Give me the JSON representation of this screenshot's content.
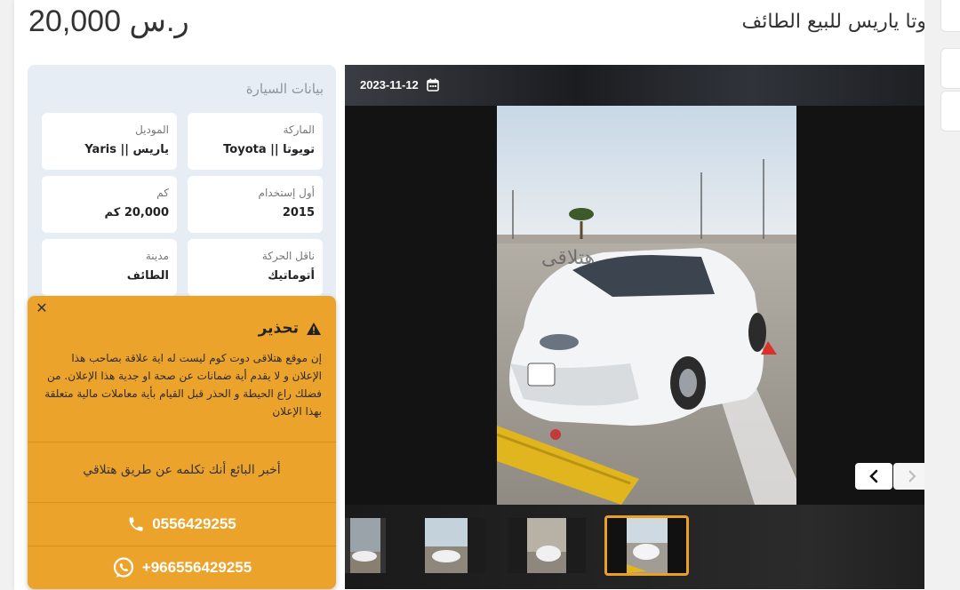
{
  "header": {
    "price": "20,000 ر.س",
    "title": "وتا ياريس للبيع الطائف"
  },
  "specs": {
    "section_title": "بيانات السيارة",
    "items": [
      {
        "label": "الماركة",
        "value": "تويوتا || Toyota"
      },
      {
        "label": "الموديل",
        "value": "ياريس || Yaris"
      },
      {
        "label": "أول إستخدام",
        "value": "2015"
      },
      {
        "label": "كم",
        "value": "20,000 كم"
      },
      {
        "label": "ناقل الحركة",
        "value": "أتوماتيك"
      },
      {
        "label": "مدينة",
        "value": "الطائف"
      }
    ]
  },
  "warning": {
    "title": "تحذير",
    "body": "إن موقع هتلاقى دوت كوم ليست له اية علاقة بصاحب هذا الإعلان و لا يقدم أية ضمانات عن صحة او جدية هذا الإعلان. من فضلك راع الحيطة و الحذر قبل القيام بأية معاملات مالية متعلقة بهذا الإعلان",
    "inform_seller": "أخبر البائع أنك تكلمه عن طريق هتلاقي",
    "phone": "0556429255",
    "whatsapp": "+966556429255"
  },
  "gallery": {
    "date": "2023-11-12",
    "watermark": "هتلاقى"
  },
  "colors": {
    "warning_bg": "#eca32b",
    "specs_bg": "#e7edf4",
    "active_thumb_border": "#e8a02a"
  },
  "icons": [
    "calendar-icon",
    "warning-triangle-icon",
    "close-icon",
    "phone-icon",
    "whatsapp-icon",
    "chevron-left-icon",
    "chevron-right-icon"
  ]
}
